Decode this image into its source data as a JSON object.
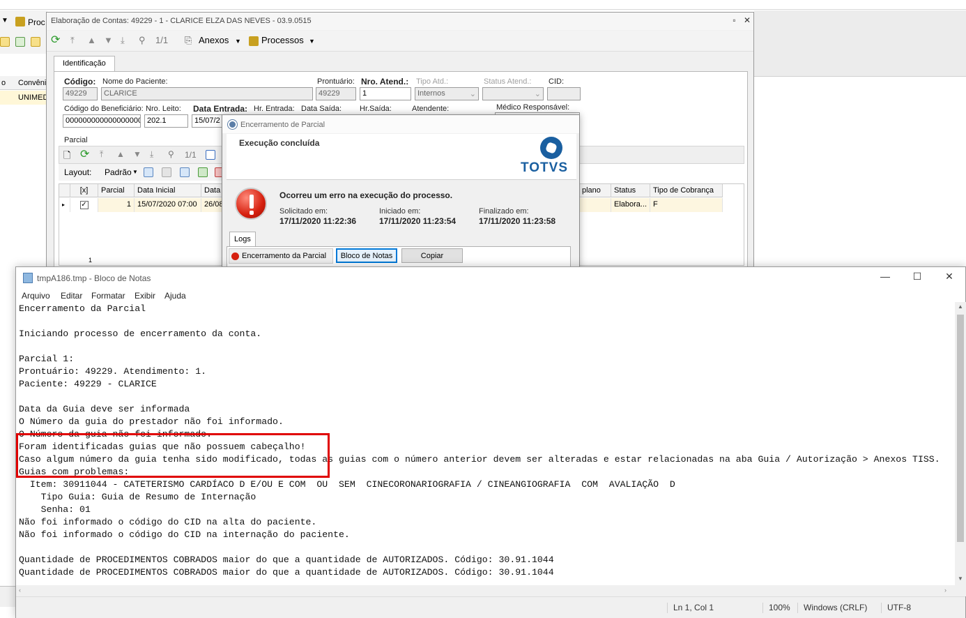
{
  "background_app": {
    "toolbar_label": "Proc",
    "grid_col_1": "o",
    "grid_col_2": "Convêni",
    "grid_cell": "UNIMED"
  },
  "elab_window": {
    "title": "Elaboração de Contas: 49229 - 1 - CLARICE ELZA DAS NEVES - 03.9.0515",
    "page_counter": "1/1",
    "anexos_label": "Anexos",
    "processos_label": "Processos",
    "tab_identificacao": "Identificação",
    "fields": {
      "codigo_label": "Código:",
      "codigo_value": "49229",
      "nome_label": "Nome do Paciente:",
      "nome_value": "CLARICE",
      "prontuario_label": "Prontuário:",
      "prontuario_value": "49229",
      "nro_atend_label": "Nro. Atend.:",
      "nro_atend_value": "1",
      "tipo_atd_label": "Tipo Atd.:",
      "tipo_atd_value": "Internos",
      "status_atend_label": "Status Atend.:",
      "cid_label": "CID:",
      "cod_benef_label": "Código do Beneficiário:",
      "cod_benef_value": "0000000000000000000",
      "nro_leito_label": "Nro. Leito:",
      "nro_leito_value": "202.1",
      "data_entrada_label": "Data Entrada:",
      "data_entrada_value": "15/07/2",
      "hr_entrada_label": "Hr. Entrada:",
      "data_saida_label": "Data Saída:",
      "hr_saida_label": "Hr.Saída:",
      "atendente_label": "Atendente:",
      "medico_label": "Médico Responsável:"
    },
    "parcial": {
      "group_label": "Parcial",
      "page_counter": "1/1",
      "layout_label": "Layout:",
      "layout_value": "Padrão",
      "columns": [
        "[x]",
        "Parcial",
        "Data Inicial",
        "Data",
        "plano",
        "Status",
        "Tipo de Cobrança"
      ],
      "row": {
        "checked": "✓",
        "parcial": "1",
        "data_inicial": "15/07/2020 07:00",
        "data": "26/08",
        "status": "Elabora...",
        "tipo_cobranca": "F"
      },
      "footer_count": "1"
    }
  },
  "dialog": {
    "title": "Encerramento de Parcial",
    "header": "Execução concluída",
    "brand": "TOTVS",
    "error_message": "Ocorreu um erro na execução do processo.",
    "solicitado_label": "Solicitado em:",
    "solicitado_value": "17/11/2020 11:22:36",
    "iniciado_label": "Iniciado em:",
    "iniciado_value": "17/11/2020 11:23:54",
    "finalizado_label": "Finalizado em:",
    "finalizado_value": "17/11/2020 11:23:58",
    "logs_tab": "Logs",
    "log_item": "Encerramento da Parcial",
    "bloco_button": "Bloco de Notas",
    "copiar_button": "Copiar"
  },
  "notepad": {
    "title": "tmpA186.tmp - Bloco de Notas",
    "menu": [
      "Arquivo",
      "Editar",
      "Formatar",
      "Exibir",
      "Ajuda"
    ],
    "lines": [
      "Encerramento da Parcial",
      "",
      "Iniciando processo de encerramento da conta.",
      "",
      "Parcial 1:",
      "Prontuário: 49229. Atendimento: 1.",
      "Paciente: 49229 - CLARICE",
      "",
      "Data da Guia deve ser informada",
      "O Número da guia do prestador não foi informado.",
      "O Número da guia não foi informado.",
      "Foram identificadas guias que não possuem cabeçalho!",
      "Caso algum número da guia tenha sido modificado, todas as guias com o número anterior devem ser alteradas e estar relacionadas na aba Guia / Autorização > Anexos TISS.",
      "Guias com problemas:",
      "  Item: 30911044 - CATETERISMO CARDÍACO D E/OU E COM  OU  SEM  CINECORONARIOGRAFIA / CINEANGIOGRAFIA  COM  AVALIAÇÃO  D",
      "    Tipo Guia: Guia de Resumo de Internação",
      "    Senha: 01",
      "Não foi informado o código do CID na alta do paciente.",
      "Não foi informado o código do CID na internação do paciente.",
      "",
      "Quantidade de PROCEDIMENTOS COBRADOS maior do que a quantidade de AUTORIZADOS. Código: 30.91.1044",
      "Quantidade de PROCEDIMENTOS COBRADOS maior do que a quantidade de AUTORIZADOS. Código: 30.91.1044"
    ],
    "status": {
      "position": "Ln 1, Col 1",
      "zoom": "100%",
      "line_ending": "Windows (CRLF)",
      "encoding": "UTF-8"
    }
  }
}
